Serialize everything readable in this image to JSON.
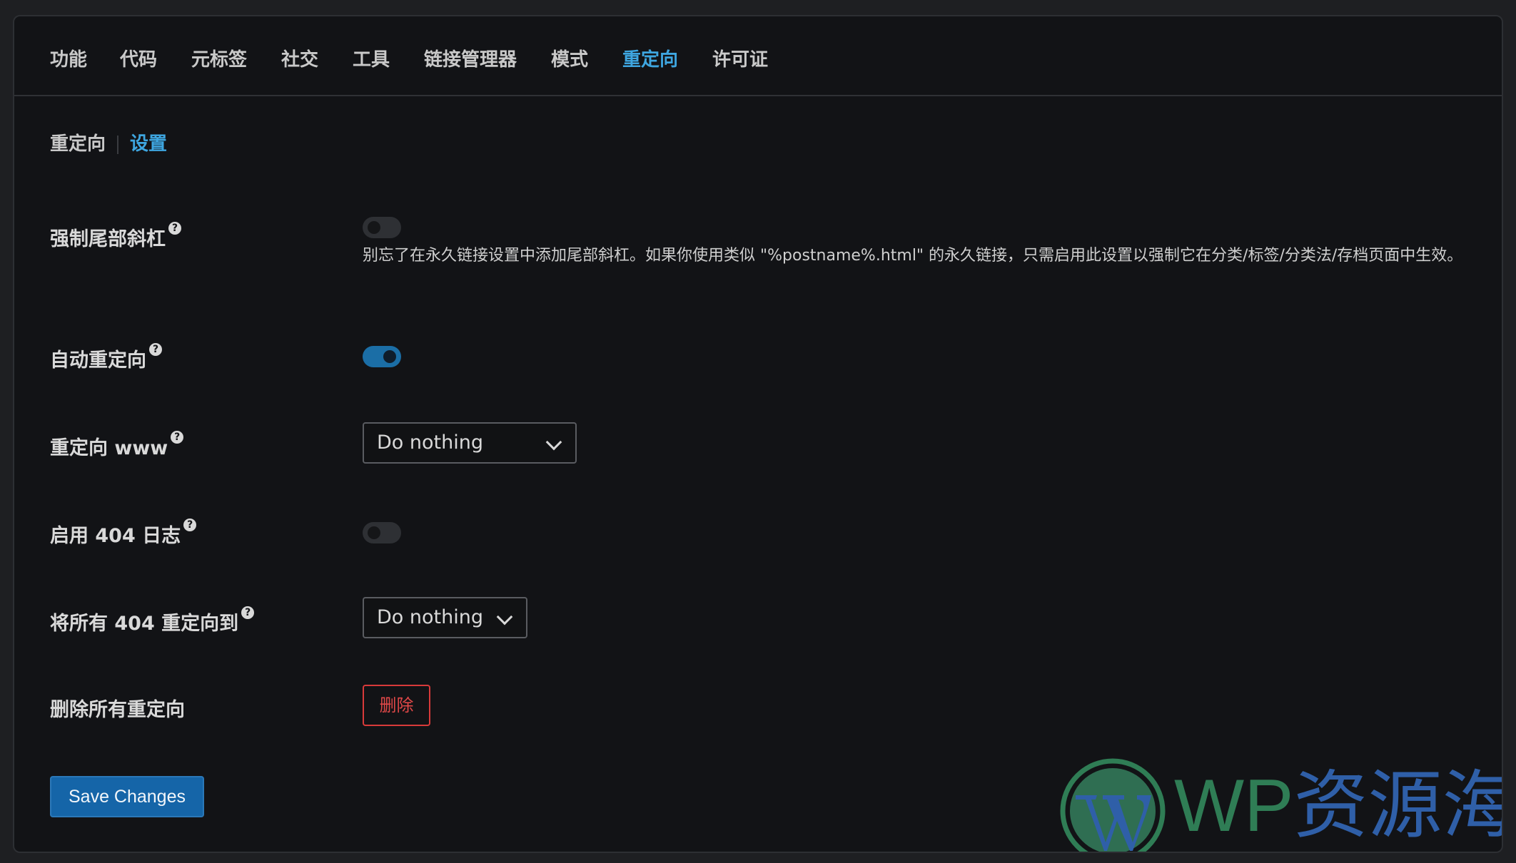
{
  "tabs": [
    {
      "label": "功能",
      "active": false
    },
    {
      "label": "代码",
      "active": false
    },
    {
      "label": "元标签",
      "active": false
    },
    {
      "label": "社交",
      "active": false
    },
    {
      "label": "工具",
      "active": false
    },
    {
      "label": "链接管理器",
      "active": false
    },
    {
      "label": "模式",
      "active": false
    },
    {
      "label": "重定向",
      "active": true
    },
    {
      "label": "许可证",
      "active": false
    }
  ],
  "subnav": {
    "redirects": "重定向",
    "settings": "设置"
  },
  "settings": {
    "force_trailing_slash": {
      "label": "强制尾部斜杠",
      "enabled": false,
      "description": "别忘了在永久链接设置中添加尾部斜杠。如果你使用类似 \"%postname%.html\" 的永久链接，只需启用此设置以强制它在分类/标签/分类法/存档页面中生效。"
    },
    "auto_redirect": {
      "label": "自动重定向",
      "enabled": true
    },
    "redirect_www": {
      "label": "重定向 www",
      "value": "Do nothing"
    },
    "enable_404_log": {
      "label": "启用 404 日志",
      "enabled": false
    },
    "redirect_all_404": {
      "label": "将所有 404 重定向到",
      "value": "Do nothing"
    },
    "delete_all_redirects": {
      "label": "删除所有重定向",
      "button": "删除"
    }
  },
  "help_glyph": "?",
  "save_button": "Save Changes",
  "watermark": {
    "latin": "WP",
    "cjk": "资源海",
    "icon": "wordpress-logo-icon"
  },
  "colors": {
    "accent": "#3ea6e0",
    "toggle_on": "#1b6ea6",
    "danger": "#e04848",
    "primary_button": "#1565a8"
  }
}
